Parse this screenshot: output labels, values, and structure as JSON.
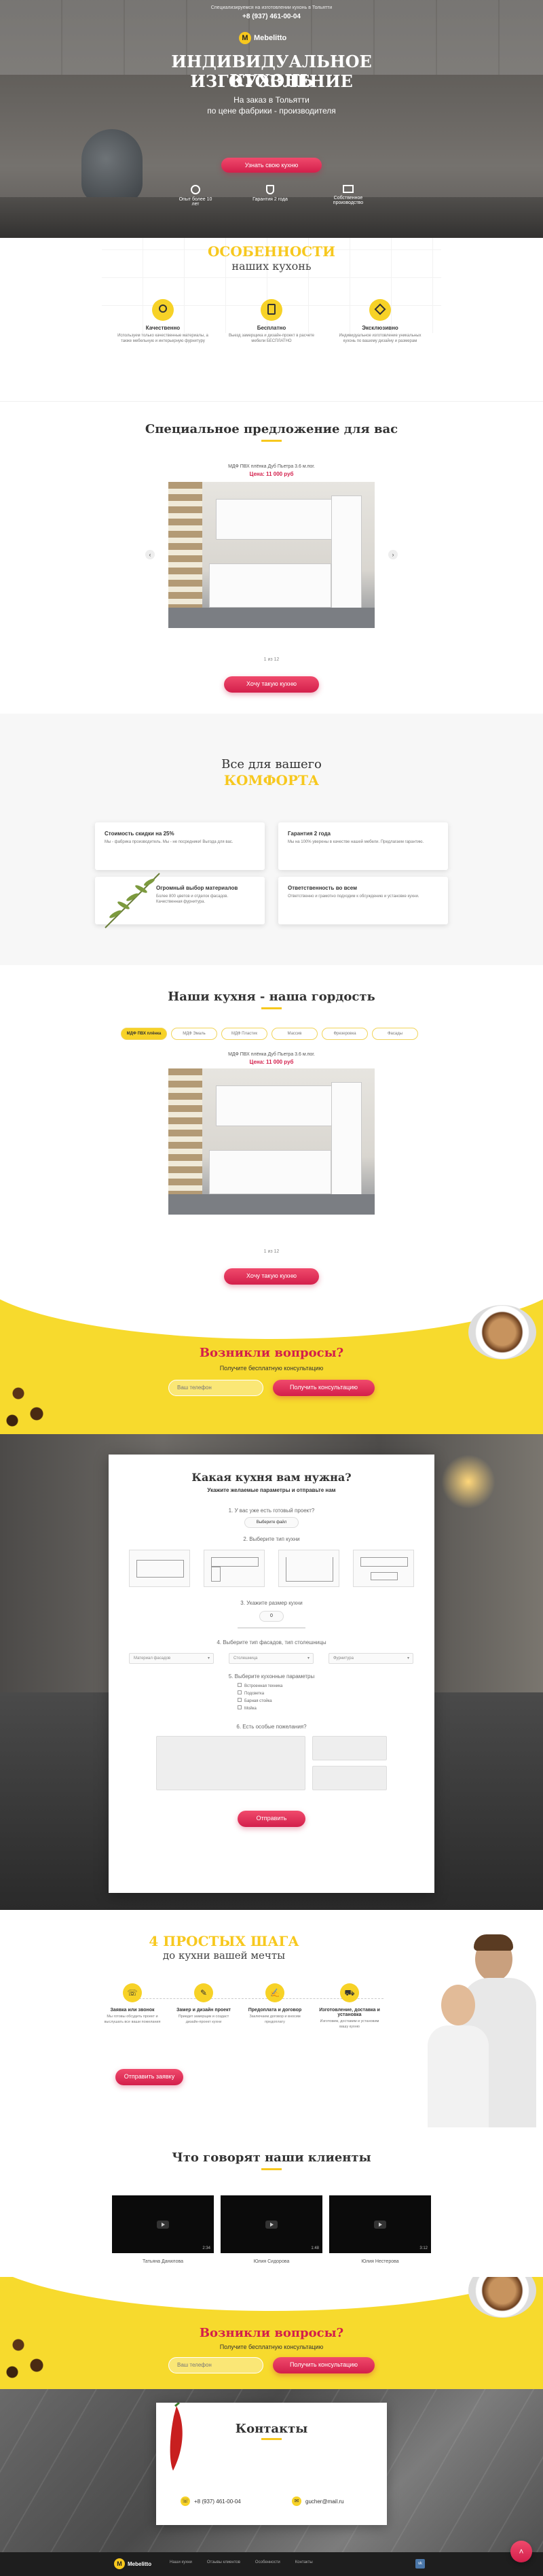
{
  "hero": {
    "logo": "Mebelitto",
    "top_note": "Специализируемся на изготовлении кухонь в Тольятти",
    "phone": "+8 (937) 461-00-04",
    "title1": "ИНДИВИДУАЛЬНОЕ ИЗГОТОВЛЕНИЕ",
    "title2": "КУХОНЬ",
    "subtitle1": "На заказ в Тольятти",
    "subtitle2": "по цене фабрики - производителя",
    "cta": "Узнать свою кухню",
    "features": [
      {
        "icon": "ruler-icon",
        "text": "Опыт более 10 лет"
      },
      {
        "icon": "shield-icon",
        "text": "Гарантия 2 года"
      },
      {
        "icon": "factory-icon",
        "text": "Собственное производство"
      }
    ]
  },
  "features": {
    "title1": "ОСОБЕННОСТИ",
    "title2": "наших кухонь",
    "items": [
      {
        "icon": "medal-icon",
        "title": "Качественно",
        "text": "Используем только качественные материалы, а также мебельную и интерьерную фурнитуру"
      },
      {
        "icon": "calculator-icon",
        "title": "Бесплатно",
        "text": "Выезд замерщика и дизайн-проект в расчете мебели БЕСПЛАТНО"
      },
      {
        "icon": "diamond-icon",
        "title": "Эксклюзивно",
        "text": "Индивидуальное изготовление уникальных кухонь по вашему дизайну и размерам"
      }
    ]
  },
  "offer": {
    "title": "Специальное предложение для вас",
    "product_name": "МДФ ПВХ плёнка Дуб Пьетра 3.6 м.пог.",
    "price": "Цена: 11 000 руб",
    "pager": "1 из 12",
    "cta": "Хочу такую кухню"
  },
  "comfort": {
    "title1": "Все для вашего",
    "title2": "КОМФОРТА",
    "items": [
      {
        "title": "Стоимость скидки на 25%",
        "text": "Мы - фабрика производитель. Мы - не посредники! Выгода для вас."
      },
      {
        "title": "Гарантия 2 года",
        "text": "Мы на 100% уверены в качестве нашей мебели. Предлагаем гарантию."
      },
      {
        "title": "Огромный выбор материалов",
        "text": "Более 800 цветов и отделок фасадов. Качественная фурнитура."
      },
      {
        "title": "Ответственность во всем",
        "text": "Ответственно и грамотно подходим к обсуждению и установке кухни."
      }
    ]
  },
  "pride": {
    "title": "Наши кухня - наша гордость",
    "tabs": [
      "МДФ ПВХ плёнка",
      "МДФ Эмаль",
      "МДФ Пластик",
      "Массив",
      "Фрезеровка",
      "Фасады"
    ],
    "product_name": "МДФ ПВХ плёнка Дуб Пьетра 3.6 м.пог.",
    "price": "Цена: 11 000 руб",
    "pager": "1 из 12",
    "cta": "Хочу такую кухню"
  },
  "questions1": {
    "title": "Возникли вопросы?",
    "subtitle": "Получите бесплатную консультацию",
    "phone_placeholder": "Ваш телефон",
    "cta": "Получить консультацию"
  },
  "quiz": {
    "title": "Какая кухня вам нужна?",
    "subtitle": "Укажите желаемые параметры и отправьте нам",
    "q1": "1. У вас уже есть готовый проект?",
    "q1_opt": "Выберите файл",
    "q2": "2. Выберите тип кухни",
    "q3": "3. Укажите размер кухни",
    "q3_val": "0",
    "q4": "4. Выберите тип фасадов, тип столешницы",
    "selects": [
      "Материал фасадов",
      "Столешница",
      "Фурнитура"
    ],
    "q5": "5. Выберите кухонные параметры",
    "checks": [
      "Встроенная техника",
      "Подсветка",
      "Барная стойка",
      "Мойка"
    ],
    "q6": "6. Есть особые пожелания?",
    "cta": "Отправить"
  },
  "steps": {
    "title1": "4 ПРОСТЫХ ШАГА",
    "title2": "до кухни вашей мечты",
    "items": [
      {
        "num": "01",
        "icon": "phone-icon",
        "title": "Заявка или звонок",
        "text": "Мы готовы обсудить проект и выслушать все ваши пожелания"
      },
      {
        "num": "02",
        "icon": "compass-icon",
        "title": "Замер и дизайн проект",
        "text": "Приедет замерщик и создаст дизайн-проект кухни"
      },
      {
        "num": "03",
        "icon": "contract-icon",
        "title": "Предоплата и договор",
        "text": "Заключаем договор и вносим предоплату"
      },
      {
        "num": "04",
        "icon": "truck-icon",
        "title": "Изготовление, доставка и установка",
        "text": "Изготовим, доставим и установим вашу кухню"
      }
    ],
    "cta": "Отправить заявку"
  },
  "reviews": {
    "title": "Что говорят наши клиенты",
    "videos": [
      {
        "name": "Татьяна Данилова",
        "time": "2:34"
      },
      {
        "name": "Юлия Сидорова",
        "time": "1:48"
      },
      {
        "name": "Юлия Нестерова",
        "time": "3:12"
      }
    ]
  },
  "questions2": {
    "title": "Возникли вопросы?",
    "subtitle": "Получите бесплатную консультацию",
    "phone_placeholder": "Ваш телефон",
    "cta": "Получить консультацию"
  },
  "contacts": {
    "title": "Контакты",
    "phone": "+8 (937) 461-00-04",
    "email": "gucher@mail.ru"
  },
  "footer": {
    "logo": "Mebelitto",
    "links": [
      "Наши кухни",
      "Отзывы клиентов",
      "Особенности",
      "Контакты"
    ]
  },
  "colors": {
    "accent": "#f7c81e",
    "red": "#d31f4b",
    "dark": "#2b2b2b"
  }
}
